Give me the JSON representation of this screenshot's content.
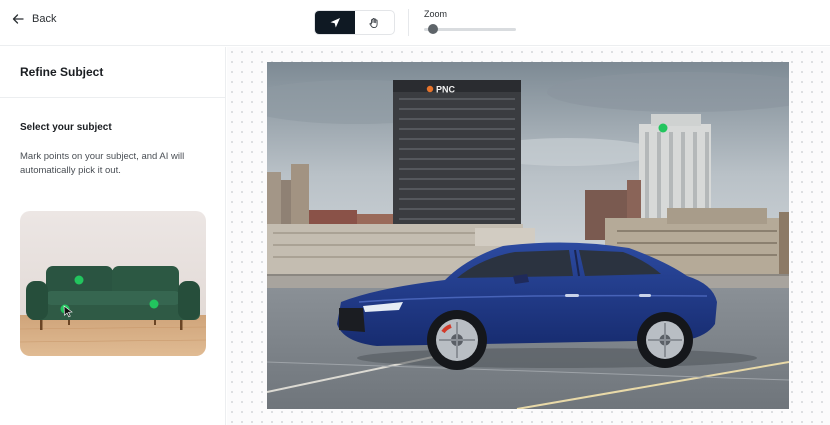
{
  "header": {
    "back_label": "Back",
    "back_icon": "arrow-left-icon",
    "tools": [
      {
        "name": "select",
        "icon": "cursor-arrow-icon",
        "active": true
      },
      {
        "name": "pan",
        "icon": "hand-icon",
        "active": false
      }
    ],
    "zoom": {
      "label": "Zoom",
      "level": 0.1
    }
  },
  "panel": {
    "title": "Refine Subject",
    "subtitle": "Select your subject",
    "description": "Mark points on your subject, and AI will automatically pick it out."
  },
  "photo": {
    "building_sign": "PNC",
    "marker_count": 1
  },
  "thumbnail": {
    "marker_count": 3
  },
  "colors": {
    "accent": "#0f1923",
    "marker": "#22c55e",
    "car": "#1f3a8c",
    "sofa": "#2f5a45"
  }
}
